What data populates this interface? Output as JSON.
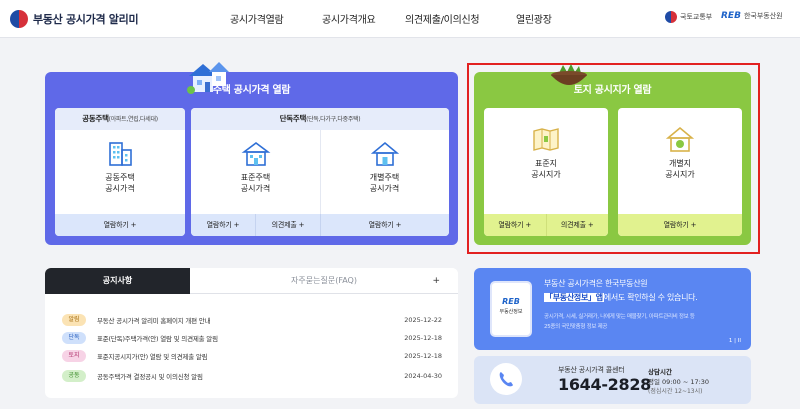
{
  "header": {
    "logo_text": "부동산 공시가격 알리미",
    "nav": [
      "공시가격열람",
      "공시가격개요",
      "의견제출/이의신청",
      "열린광장"
    ],
    "partner1": "국토교통부",
    "partner2_mark": "REB",
    "partner2": "한국부동산원"
  },
  "housing": {
    "title": "주택 공시가격 열람",
    "apartment": {
      "head": "공동주택",
      "head_sub": "(아파트,연립,다세대)",
      "label_l1": "공동주택",
      "label_l2": "공시가격",
      "button": "열람하기 +"
    },
    "detached": {
      "head": "단독주택",
      "head_sub": "(단독,다가구,다중주택)",
      "standard_l1": "표준주택",
      "standard_l2": "공시가격",
      "individual_l1": "개별주택",
      "individual_l2": "공시가격",
      "btn_view": "열람하기 +",
      "btn_opinion": "의견제출 +",
      "btn_view2": "열람하기 +"
    }
  },
  "land": {
    "title": "토지 공시지가 열람",
    "standard_l1": "표준지",
    "standard_l2": "공시지가",
    "individual_l1": "개별지",
    "individual_l2": "공시지가",
    "btn_view": "열람하기 +",
    "btn_opinion": "의견제출 +",
    "btn_view2": "열람하기 +"
  },
  "notice": {
    "tab_active": "공지사항",
    "tab_inactive": "자주묻는질문(FAQ)",
    "more": "+",
    "items": [
      {
        "tag": "알림",
        "title": "부동산 공시가격 알리미 홈페이지 개편 안내",
        "date": "2025-12-22"
      },
      {
        "tag": "단독",
        "title": "표준(단독)주택가격(안) 열람 및 의견제출 알림",
        "date": "2025-12-18"
      },
      {
        "tag": "토지",
        "title": "표준지공시지가(안) 열람 및 의견제출 알림",
        "date": "2025-12-18"
      },
      {
        "tag": "공동",
        "title": "공동주택가격 결정공시 및 이의신청 알림",
        "date": "2024-04-30"
      }
    ],
    "tag_colors": {
      "알림": "#fbe3b4",
      "단독": "#cfe0fb",
      "토지": "#f7d3e6",
      "공동": "#d3efc9"
    }
  },
  "promo": {
    "line1": "부동산 공시가격은 한국부동산원",
    "line2_highlight": "「부동산정보」앱",
    "line2_rest": "에서도 확인하실 수 있습니다.",
    "sub1": "공시가격, 시세, 실거래가, 나에게 맞는 매물찾기, 아파트관리비 정보 등",
    "sub2": "25종의 국민맞춤형 정보 제공",
    "phone_mark": "REB",
    "phone_sub": "부동산정보",
    "pager": "1 | II"
  },
  "call": {
    "label": "부동산 공시가격 콜센터",
    "number": "1644-2828",
    "hours_title": "상담시간",
    "hours_1": "평일 09:00 ~ 17:30",
    "hours_2": "(점심시간 12~13시)"
  },
  "colors": {
    "housing_panel": "#5f69e8",
    "land_panel": "#8ac842",
    "highlight_frame": "#e22020",
    "promo": "#5a86f2"
  }
}
